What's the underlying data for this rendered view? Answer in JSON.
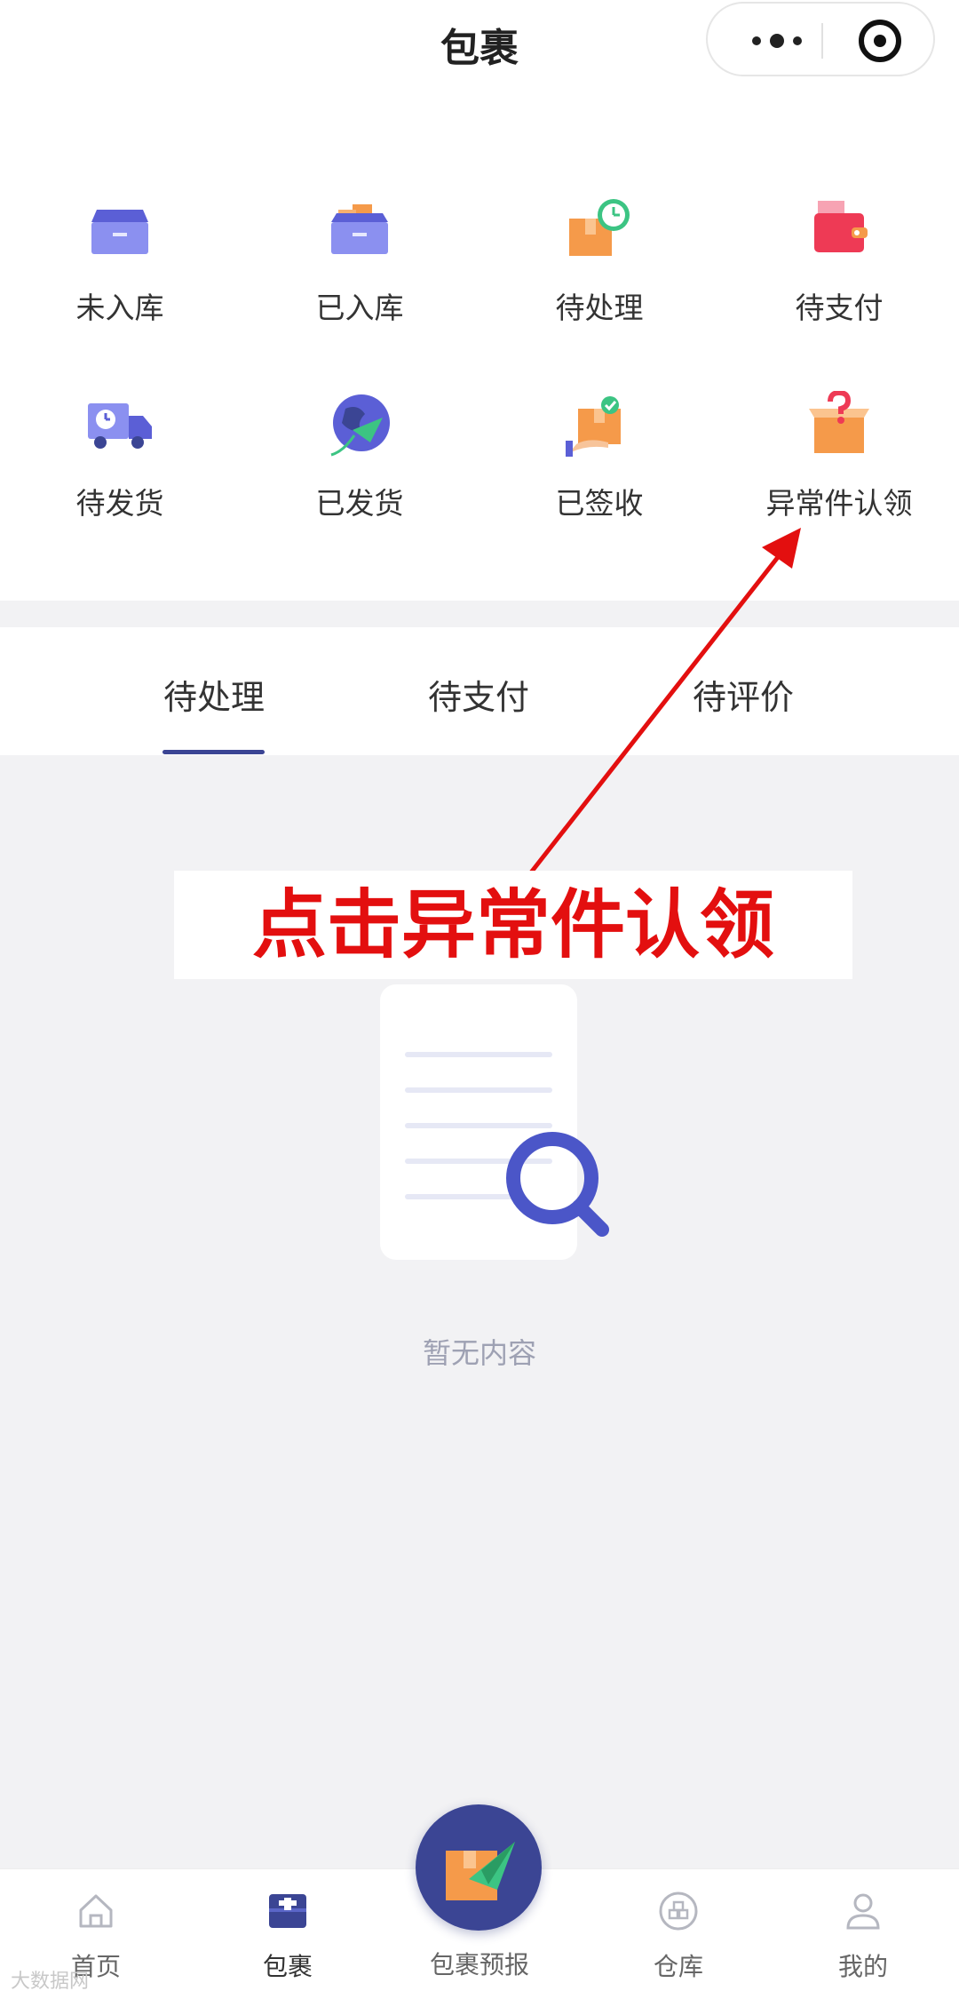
{
  "header": {
    "title": "包裹"
  },
  "status_grid": [
    {
      "label": "未入库",
      "icon": "empty-box-icon"
    },
    {
      "label": "已入库",
      "icon": "stored-box-icon"
    },
    {
      "label": "待处理",
      "icon": "box-clock-icon"
    },
    {
      "label": "待支付",
      "icon": "wallet-icon"
    },
    {
      "label": "待发货",
      "icon": "truck-clock-icon"
    },
    {
      "label": "已发货",
      "icon": "globe-plane-icon"
    },
    {
      "label": "已签收",
      "icon": "box-check-icon"
    },
    {
      "label": "异常件认领",
      "icon": "box-question-icon"
    }
  ],
  "tabs": [
    {
      "label": "待处理",
      "active": true
    },
    {
      "label": "待支付",
      "active": false
    },
    {
      "label": "待评价",
      "active": false
    }
  ],
  "empty_state": {
    "text": "暂无内容",
    "icon": "document-search-icon"
  },
  "annotation": {
    "text": "点击异常件认领",
    "color": "#e30f0f"
  },
  "tabbar": [
    {
      "label": "首页",
      "icon": "home-icon"
    },
    {
      "label": "包裹",
      "icon": "package-icon",
      "active": true
    },
    {
      "label": "包裹预报",
      "icon": "send-package-icon",
      "featured": true
    },
    {
      "label": "仓库",
      "icon": "warehouse-icon"
    },
    {
      "label": "我的",
      "icon": "user-icon"
    }
  ],
  "watermark": "大数据网",
  "colors": {
    "accent": "#3b4594",
    "annotation": "#e30f0f",
    "orange": "#f59a4a",
    "lavender": "#8b90f0"
  }
}
